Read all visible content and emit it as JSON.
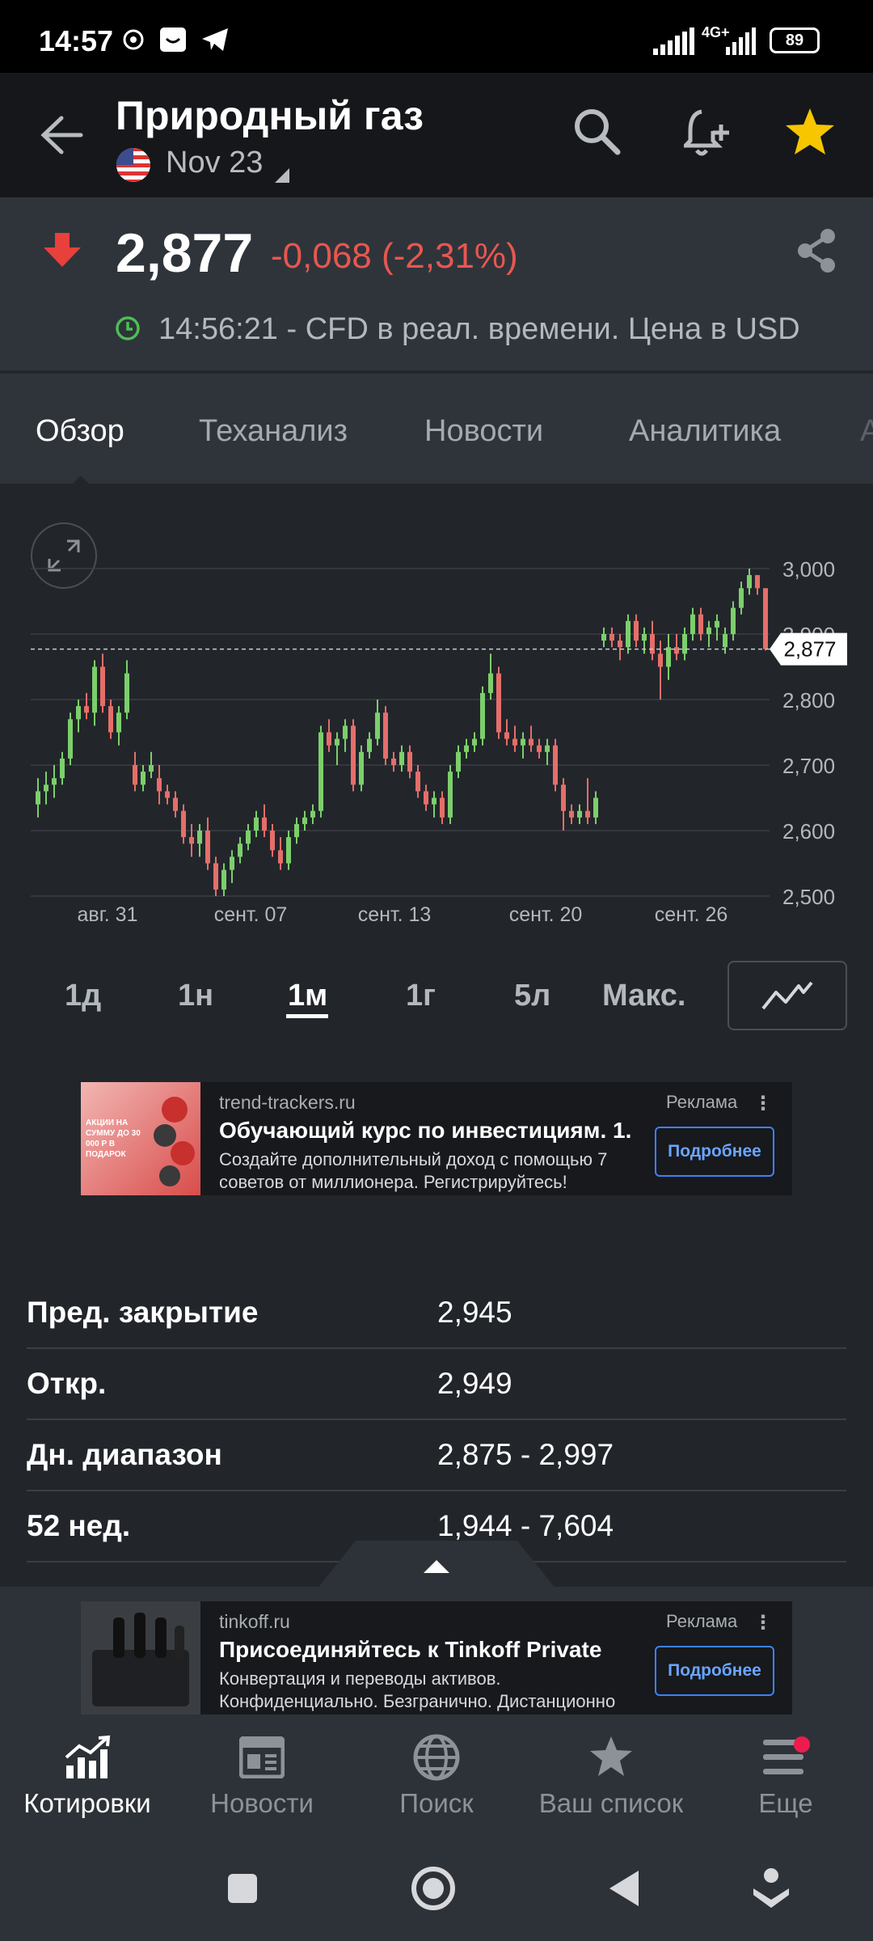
{
  "status_bar": {
    "time": "14:57",
    "network": "4G+",
    "battery": "89"
  },
  "header": {
    "back_icon": "arrow-left-icon",
    "title": "Природный газ",
    "flag_icon": "us-flag-icon",
    "contract": "Nov 23",
    "search_icon": "search-icon",
    "alert_icon": "bell-plus-icon",
    "favorite_icon": "star-icon",
    "favorite_color": "#f7c600"
  },
  "quote": {
    "direction_icon": "arrow-down-icon",
    "price": "2,877",
    "change": "-0,068 (-2,31%)",
    "change_color": "#e8574f",
    "realtime": "14:56:21 - CFD в реал. времени. Цена в USD",
    "share_icon": "share-icon"
  },
  "tabs": [
    {
      "label": "Обзор",
      "active": true
    },
    {
      "label": "Теханализ",
      "active": false
    },
    {
      "label": "Новости",
      "active": false
    },
    {
      "label": "Аналитика",
      "active": false
    }
  ],
  "chart_data": {
    "type": "candlestick",
    "current_price": 2.877,
    "current_price_label": "2,877",
    "ylim": [
      2.5,
      3.0
    ],
    "y_ticks": [
      "3,000",
      "2,900",
      "2,800",
      "2,700",
      "2,600",
      "2,500"
    ],
    "x_ticks": [
      "авг. 31",
      "сент. 07",
      "сент. 13",
      "сент. 20",
      "сент. 26"
    ],
    "grid": true,
    "up_color": "#7ccf6b",
    "down_color": "#e56e6a",
    "candles": [
      [
        2.64,
        2.68,
        2.62,
        2.66
      ],
      [
        2.66,
        2.69,
        2.64,
        2.67
      ],
      [
        2.67,
        2.7,
        2.65,
        2.68
      ],
      [
        2.68,
        2.72,
        2.67,
        2.71
      ],
      [
        2.71,
        2.78,
        2.7,
        2.77
      ],
      [
        2.77,
        2.8,
        2.75,
        2.79
      ],
      [
        2.79,
        2.81,
        2.77,
        2.78
      ],
      [
        2.78,
        2.86,
        2.76,
        2.85
      ],
      [
        2.85,
        2.87,
        2.78,
        2.79
      ],
      [
        2.79,
        2.8,
        2.74,
        2.75
      ],
      [
        2.75,
        2.79,
        2.73,
        2.78
      ],
      [
        2.78,
        2.86,
        2.77,
        2.84
      ],
      [
        2.7,
        2.72,
        2.66,
        2.67
      ],
      [
        2.67,
        2.7,
        2.66,
        2.69
      ],
      [
        2.69,
        2.72,
        2.68,
        2.7
      ],
      [
        2.68,
        2.7,
        2.64,
        2.66
      ],
      [
        2.66,
        2.67,
        2.64,
        2.65
      ],
      [
        2.65,
        2.66,
        2.62,
        2.63
      ],
      [
        2.63,
        2.64,
        2.58,
        2.59
      ],
      [
        2.59,
        2.61,
        2.56,
        2.58
      ],
      [
        2.58,
        2.61,
        2.56,
        2.6
      ],
      [
        2.6,
        2.62,
        2.54,
        2.55
      ],
      [
        2.55,
        2.56,
        2.5,
        2.51
      ],
      [
        2.51,
        2.55,
        2.5,
        2.54
      ],
      [
        2.54,
        2.57,
        2.52,
        2.56
      ],
      [
        2.56,
        2.59,
        2.55,
        2.58
      ],
      [
        2.58,
        2.61,
        2.57,
        2.6
      ],
      [
        2.6,
        2.63,
        2.59,
        2.62
      ],
      [
        2.62,
        2.64,
        2.59,
        2.6
      ],
      [
        2.6,
        2.61,
        2.56,
        2.57
      ],
      [
        2.57,
        2.59,
        2.54,
        2.55
      ],
      [
        2.55,
        2.6,
        2.54,
        2.59
      ],
      [
        2.59,
        2.62,
        2.58,
        2.61
      ],
      [
        2.61,
        2.63,
        2.6,
        2.62
      ],
      [
        2.62,
        2.64,
        2.61,
        2.63
      ],
      [
        2.63,
        2.76,
        2.62,
        2.75
      ],
      [
        2.75,
        2.77,
        2.72,
        2.73
      ],
      [
        2.73,
        2.75,
        2.7,
        2.74
      ],
      [
        2.74,
        2.77,
        2.72,
        2.76
      ],
      [
        2.76,
        2.77,
        2.66,
        2.67
      ],
      [
        2.67,
        2.73,
        2.66,
        2.72
      ],
      [
        2.72,
        2.75,
        2.71,
        2.74
      ],
      [
        2.74,
        2.8,
        2.73,
        2.78
      ],
      [
        2.78,
        2.79,
        2.7,
        2.71
      ],
      [
        2.71,
        2.72,
        2.69,
        2.7
      ],
      [
        2.7,
        2.73,
        2.69,
        2.72
      ],
      [
        2.72,
        2.73,
        2.68,
        2.69
      ],
      [
        2.69,
        2.7,
        2.65,
        2.66
      ],
      [
        2.66,
        2.67,
        2.63,
        2.64
      ],
      [
        2.64,
        2.66,
        2.62,
        2.65
      ],
      [
        2.65,
        2.66,
        2.61,
        2.62
      ],
      [
        2.62,
        2.7,
        2.61,
        2.69
      ],
      [
        2.69,
        2.73,
        2.68,
        2.72
      ],
      [
        2.72,
        2.74,
        2.71,
        2.73
      ],
      [
        2.73,
        2.75,
        2.72,
        2.74
      ],
      [
        2.74,
        2.82,
        2.73,
        2.81
      ],
      [
        2.81,
        2.87,
        2.8,
        2.84
      ],
      [
        2.84,
        2.85,
        2.74,
        2.75
      ],
      [
        2.75,
        2.77,
        2.73,
        2.74
      ],
      [
        2.74,
        2.76,
        2.72,
        2.73
      ],
      [
        2.73,
        2.75,
        2.71,
        2.74
      ],
      [
        2.74,
        2.76,
        2.72,
        2.73
      ],
      [
        2.73,
        2.74,
        2.71,
        2.72
      ],
      [
        2.72,
        2.74,
        2.7,
        2.73
      ],
      [
        2.73,
        2.74,
        2.66,
        2.67
      ],
      [
        2.67,
        2.68,
        2.6,
        2.63
      ],
      [
        2.63,
        2.64,
        2.61,
        2.62
      ],
      [
        2.62,
        2.64,
        2.61,
        2.63
      ],
      [
        2.63,
        2.68,
        2.61,
        2.62
      ],
      [
        2.62,
        2.66,
        2.61,
        2.65
      ],
      [
        2.89,
        2.91,
        2.88,
        2.9
      ],
      [
        2.9,
        2.91,
        2.88,
        2.89
      ],
      [
        2.89,
        2.9,
        2.86,
        2.88
      ],
      [
        2.88,
        2.93,
        2.87,
        2.92
      ],
      [
        2.92,
        2.93,
        2.88,
        2.89
      ],
      [
        2.89,
        2.91,
        2.87,
        2.9
      ],
      [
        2.9,
        2.92,
        2.86,
        2.87
      ],
      [
        2.87,
        2.89,
        2.8,
        2.85
      ],
      [
        2.85,
        2.9,
        2.83,
        2.88
      ],
      [
        2.88,
        2.9,
        2.86,
        2.87
      ],
      [
        2.87,
        2.91,
        2.86,
        2.9
      ],
      [
        2.9,
        2.94,
        2.89,
        2.93
      ],
      [
        2.93,
        2.94,
        2.89,
        2.9
      ],
      [
        2.9,
        2.92,
        2.88,
        2.91
      ],
      [
        2.91,
        2.93,
        2.89,
        2.92
      ],
      [
        2.88,
        2.91,
        2.87,
        2.9
      ],
      [
        2.9,
        2.95,
        2.89,
        2.94
      ],
      [
        2.94,
        2.98,
        2.93,
        2.97
      ],
      [
        2.97,
        3.0,
        2.96,
        2.99
      ],
      [
        2.99,
        2.99,
        2.96,
        2.97
      ],
      [
        2.97,
        2.97,
        2.875,
        2.877
      ]
    ]
  },
  "ranges": [
    {
      "label": "1д",
      "active": false
    },
    {
      "label": "1н",
      "active": false
    },
    {
      "label": "1м",
      "active": true
    },
    {
      "label": "1г",
      "active": false
    },
    {
      "label": "5л",
      "active": false
    },
    {
      "label": "Макс.",
      "active": false
    }
  ],
  "chart_type_icon": "line-chart-icon",
  "ad1": {
    "image_text": "АКЦИИ НА СУММУ ДО 30 000 Р В ПОДАРОК",
    "domain": "trend-trackers.ru",
    "headline": "Обучающий курс по инвестициям. 1...",
    "description": "Создайте дополнительный доход с помощью 7 советов от миллионера. Регистрируйтесь!",
    "label": "Реклама",
    "button": "Подробнее"
  },
  "stats": [
    {
      "key": "Пред. закрытие",
      "value": "2,945"
    },
    {
      "key": "Откр.",
      "value": "2,949"
    },
    {
      "key": "Дн. диапазон",
      "value": "2,875 - 2,997"
    },
    {
      "key": "52 нед.",
      "value": "1,944 - 7,604"
    }
  ],
  "ad2": {
    "domain": "tinkoff.ru",
    "headline": "Присоединяйтесь к Tinkoff Private",
    "description": "Конвертация и переводы активов. Конфиденциально. Безгранично. Дистанционно",
    "label": "Реклама",
    "button": "Подробнее"
  },
  "bottom_nav": [
    {
      "label": "Котировки",
      "icon": "chart-growth-icon",
      "active": true
    },
    {
      "label": "Новости",
      "icon": "newspaper-icon",
      "active": false
    },
    {
      "label": "Поиск",
      "icon": "globe-icon",
      "active": false
    },
    {
      "label": "Ваш список",
      "icon": "star-icon",
      "active": false
    },
    {
      "label": "Еще",
      "icon": "menu-icon",
      "active": false
    }
  ]
}
